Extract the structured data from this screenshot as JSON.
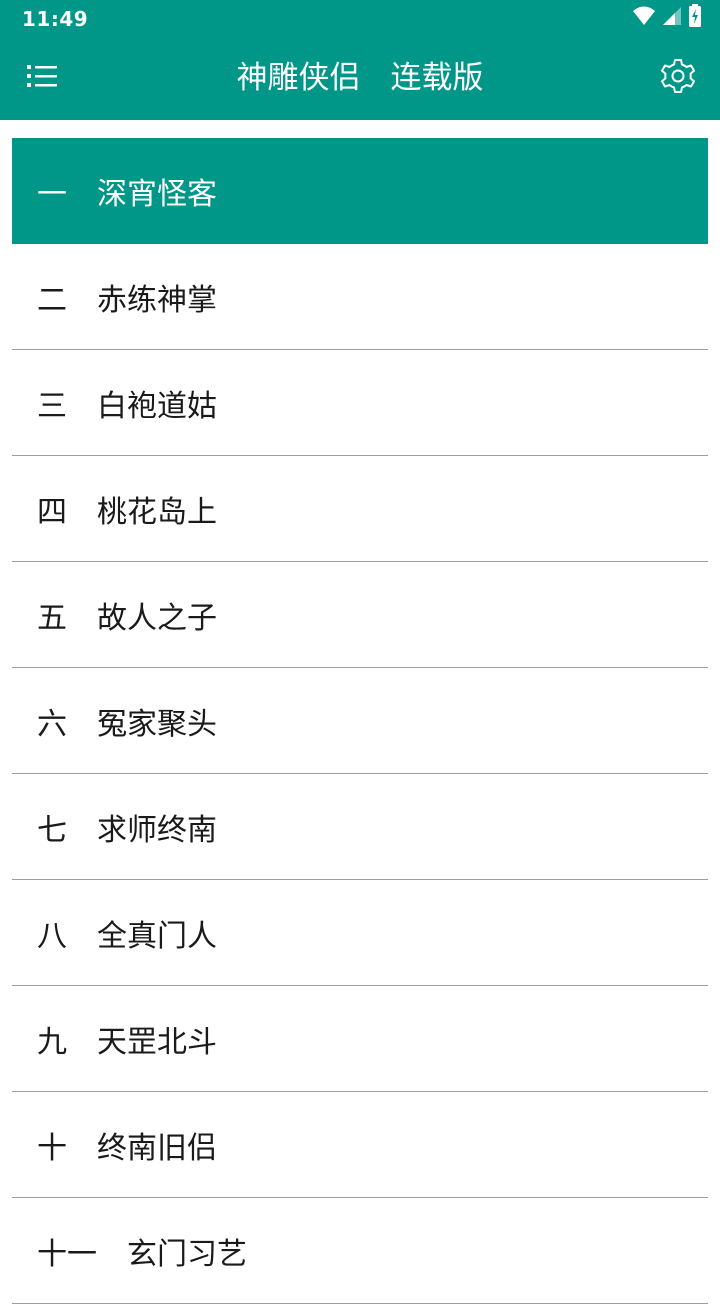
{
  "status_bar": {
    "time": "11:49",
    "icons": [
      "wifi-icon",
      "signal-icon",
      "battery-charging-icon"
    ]
  },
  "app_bar": {
    "menu_icon": "list-menu-icon",
    "title": "神雕侠侣",
    "subtitle": "连载版",
    "settings_icon": "gear-icon"
  },
  "colors": {
    "primary": "#009688",
    "text": "#1a1a1a",
    "divider": "#9e9e9e"
  },
  "chapters": [
    {
      "num": "一",
      "name": "深宵怪客",
      "selected": true
    },
    {
      "num": "二",
      "name": "赤练神掌"
    },
    {
      "num": "三",
      "name": "白袍道姑"
    },
    {
      "num": "四",
      "name": "桃花岛上"
    },
    {
      "num": "五",
      "name": "故人之子"
    },
    {
      "num": "六",
      "name": "冤家聚头"
    },
    {
      "num": "七",
      "name": "求师终南"
    },
    {
      "num": "八",
      "name": "全真门人"
    },
    {
      "num": "九",
      "name": "天罡北斗"
    },
    {
      "num": "十",
      "name": "终南旧侣"
    },
    {
      "num": "十一",
      "name": "玄门习艺"
    }
  ]
}
